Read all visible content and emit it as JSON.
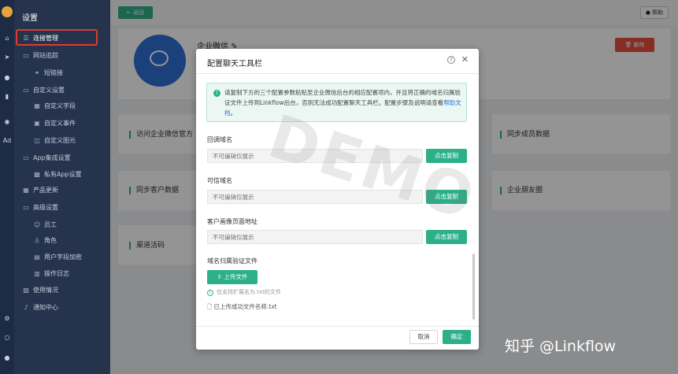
{
  "sidebar": {
    "title": "设置",
    "items": [
      {
        "icon": "list-icon",
        "label": "连接管理",
        "active": true
      },
      {
        "icon": "folder-icon",
        "label": "网站追踪"
      },
      {
        "icon": "link-icon",
        "label": "短链接"
      },
      {
        "icon": "folder-icon",
        "label": "自定义设置"
      },
      {
        "icon": "field-icon",
        "label": "自定义字段"
      },
      {
        "icon": "event-icon",
        "label": "自定义事件"
      },
      {
        "icon": "image-icon",
        "label": "自定义图元"
      },
      {
        "icon": "folder-icon",
        "label": "App集成设置"
      },
      {
        "icon": "app-icon",
        "label": "私有App设置"
      },
      {
        "icon": "grid-icon",
        "label": "产品更新"
      },
      {
        "icon": "folder-icon",
        "label": "高级设置"
      },
      {
        "icon": "user-icon",
        "label": "员工"
      },
      {
        "icon": "role-icon",
        "label": "角色"
      },
      {
        "icon": "lock-icon",
        "label": "用户字段加密"
      },
      {
        "icon": "log-icon",
        "label": "操作日志"
      },
      {
        "icon": "usage-icon",
        "label": "使用情况"
      },
      {
        "icon": "bell-icon",
        "label": "通知中心"
      }
    ]
  },
  "rail": {
    "ad_label": "Ad"
  },
  "main": {
    "back_label": "返回",
    "help_label": "帮助",
    "enterprise_title": "企业微信",
    "delete_label": "删除",
    "sections": {
      "visit": "访问企业微信官方",
      "sync_member": "同步成员数据",
      "sync_customer": "同步客户数据",
      "moments": "企业朋友圈",
      "channel_code": "渠道活码"
    }
  },
  "modal": {
    "title": "配置聊天工具栏",
    "notice_text": "请复制下方的三个配置参数粘贴至企业微信后台的相应配置项内，并且将正确的域名归属验证文件上传到Linkflow后台，否则无法成功配置聊天工具栏。配置步骤及说明请查看",
    "notice_link": "帮助文档",
    "notice_end": "。",
    "fields": [
      {
        "label": "回调域名",
        "placeholder": "不可编辑仅展示",
        "button": "点击复制"
      },
      {
        "label": "可信域名",
        "placeholder": "不可编辑仅展示",
        "button": "点击复制"
      },
      {
        "label": "客户画像页面地址",
        "placeholder": "不可编辑仅展示",
        "button": "点击复制"
      }
    ],
    "upload_label": "域名归属验证文件",
    "upload_button": "上传文件",
    "upload_hint": "仅支持扩展名为.txt的文件",
    "uploaded_file": "已上传成功文件名称.txt",
    "cancel_label": "取消",
    "ok_label": "确定"
  },
  "watermark": "DEMO",
  "credit": "知乎 @Linkflow",
  "colors": {
    "accent": "#2db08a",
    "danger": "#e94f3e",
    "sidebar": "#25344c",
    "highlight": "#e23a2c"
  }
}
